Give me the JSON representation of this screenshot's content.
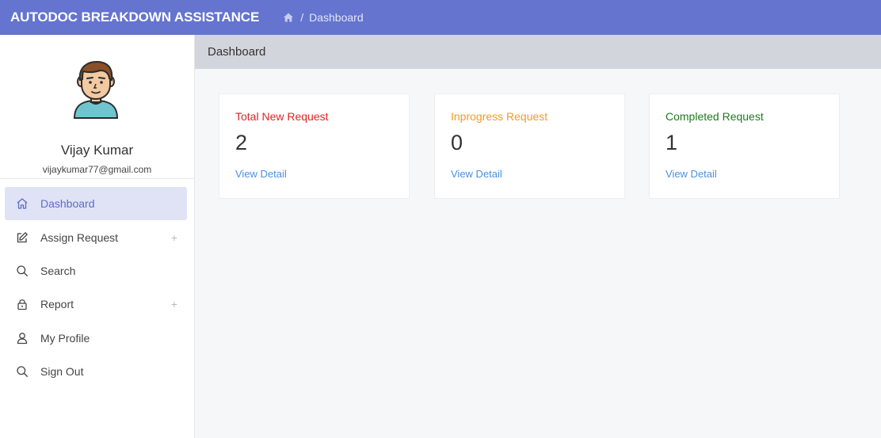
{
  "app": {
    "title": "AUTODOC BREAKDOWN ASSISTANCE",
    "breadcrumb": {
      "separator": "/",
      "current": "Dashboard"
    }
  },
  "user": {
    "name": "Vijay Kumar",
    "email": "vijaykumar77@gmail.com"
  },
  "sidebar": {
    "items": [
      {
        "label": "Dashboard",
        "icon": "home-icon",
        "active": true,
        "expandable": false
      },
      {
        "label": "Assign Request",
        "icon": "edit-icon",
        "active": false,
        "expandable": true
      },
      {
        "label": "Search",
        "icon": "search-icon",
        "active": false,
        "expandable": false
      },
      {
        "label": "Report",
        "icon": "lock-icon",
        "active": false,
        "expandable": true
      },
      {
        "label": "My Profile",
        "icon": "user-icon",
        "active": false,
        "expandable": false
      },
      {
        "label": "Sign Out",
        "icon": "search-icon",
        "active": false,
        "expandable": false
      }
    ],
    "expand_symbol": "+"
  },
  "page": {
    "header": "Dashboard"
  },
  "cards": [
    {
      "title": "Total New Request",
      "value": "2",
      "link": "View Detail",
      "color": "#e02424"
    },
    {
      "title": "Inprogress Request",
      "value": "0",
      "link": "View Detail",
      "color": "#f59a23"
    },
    {
      "title": "Completed Request",
      "value": "1",
      "link": "View Detail",
      "color": "#1e7b1e"
    }
  ],
  "colors": {
    "topbar": "#6474cf",
    "active_nav_bg": "#e0e3f6",
    "active_nav_text": "#5e6cc3",
    "link": "#4a90e2"
  }
}
